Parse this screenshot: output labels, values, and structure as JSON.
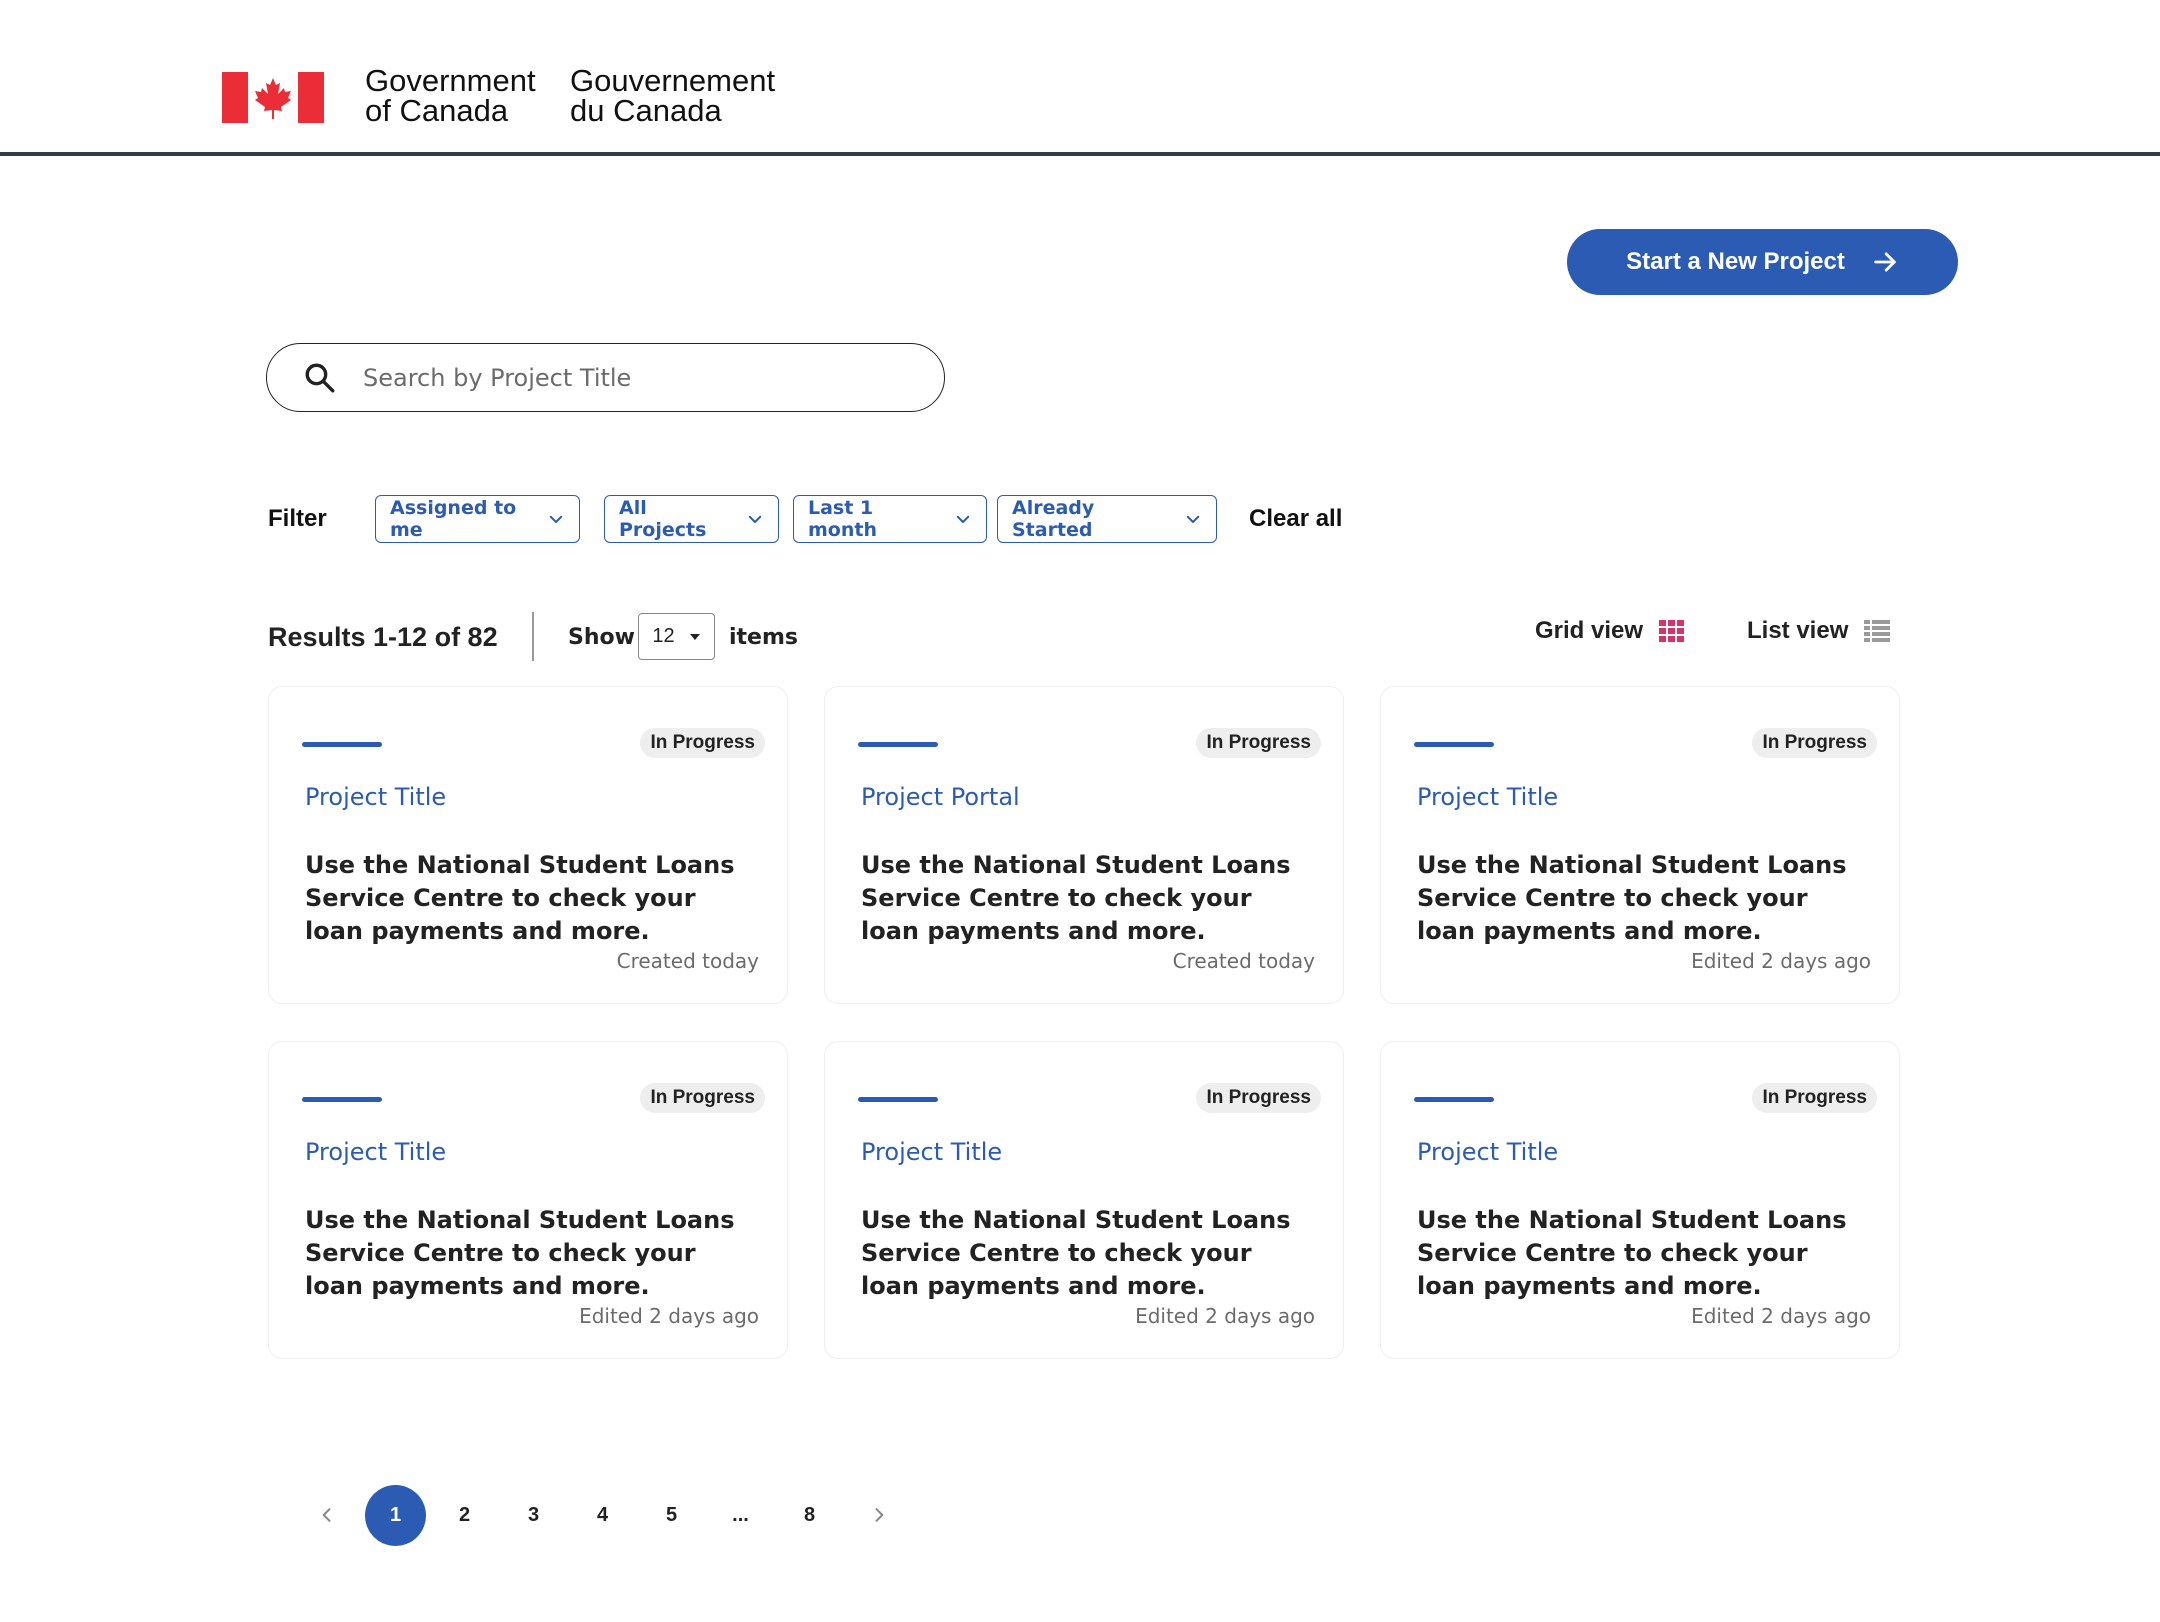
{
  "header": {
    "gov_en_line1": "Government",
    "gov_en_line2": "of Canada",
    "gov_fr_line1": "Gouvernement",
    "gov_fr_line2": "du Canada",
    "flag_icon": "canada-flag-icon",
    "colors": {
      "flag_red": "#eb2d37",
      "rule": "#333d47"
    }
  },
  "actions": {
    "start_project_label": "Start a New Project",
    "start_project_icon": "arrow-right-icon",
    "accent_color": "#2b5bb3"
  },
  "search": {
    "placeholder": "Search by Project Title",
    "value": "",
    "icon": "search-icon"
  },
  "filters": {
    "label": "Filter",
    "chips": [
      {
        "label": "Assigned to me"
      },
      {
        "label": "All Projects"
      },
      {
        "label": "Last 1 month"
      },
      {
        "label": "Already Started"
      }
    ],
    "clear_label": "Clear all"
  },
  "results": {
    "summary": "Results 1-12 of 82",
    "show_label": "Show",
    "per_page": "12",
    "items_label": "items"
  },
  "views": {
    "grid_label": "Grid view",
    "list_label": "List view",
    "grid_icon": "grid-icon",
    "list_icon": "list-icon",
    "active": "grid",
    "grid_icon_color": "#d6336c"
  },
  "cards": [
    {
      "status": "In Progress",
      "title": "Project Title",
      "description": "Use the National Student Loans Service Centre to check your loan payments and more.",
      "meta": "Created today"
    },
    {
      "status": "In Progress",
      "title": "Project Portal",
      "description": "Use the National Student Loans Service Centre to check your loan payments and more.",
      "meta": "Created today"
    },
    {
      "status": "In Progress",
      "title": "Project Title",
      "description": "Use the National Student Loans Service Centre to check your loan payments and more.",
      "meta": "Edited 2 days ago"
    },
    {
      "status": "In Progress",
      "title": "Project Title",
      "description": "Use the National Student Loans Service Centre to check your loan payments and more.",
      "meta": "Edited 2 days ago"
    },
    {
      "status": "In Progress",
      "title": "Project Title",
      "description": "Use the National Student Loans Service Centre to check your loan payments and more.",
      "meta": "Edited 2 days ago"
    },
    {
      "status": "In Progress",
      "title": "Project Title",
      "description": "Use the National Student Loans Service Centre to check your loan payments and more.",
      "meta": "Edited 2 days ago"
    }
  ],
  "pagination": {
    "pages": [
      "1",
      "2",
      "3",
      "4",
      "5",
      "...",
      "8"
    ],
    "current": "1",
    "prev_icon": "chevron-left-icon",
    "next_icon": "chevron-right-icon"
  }
}
